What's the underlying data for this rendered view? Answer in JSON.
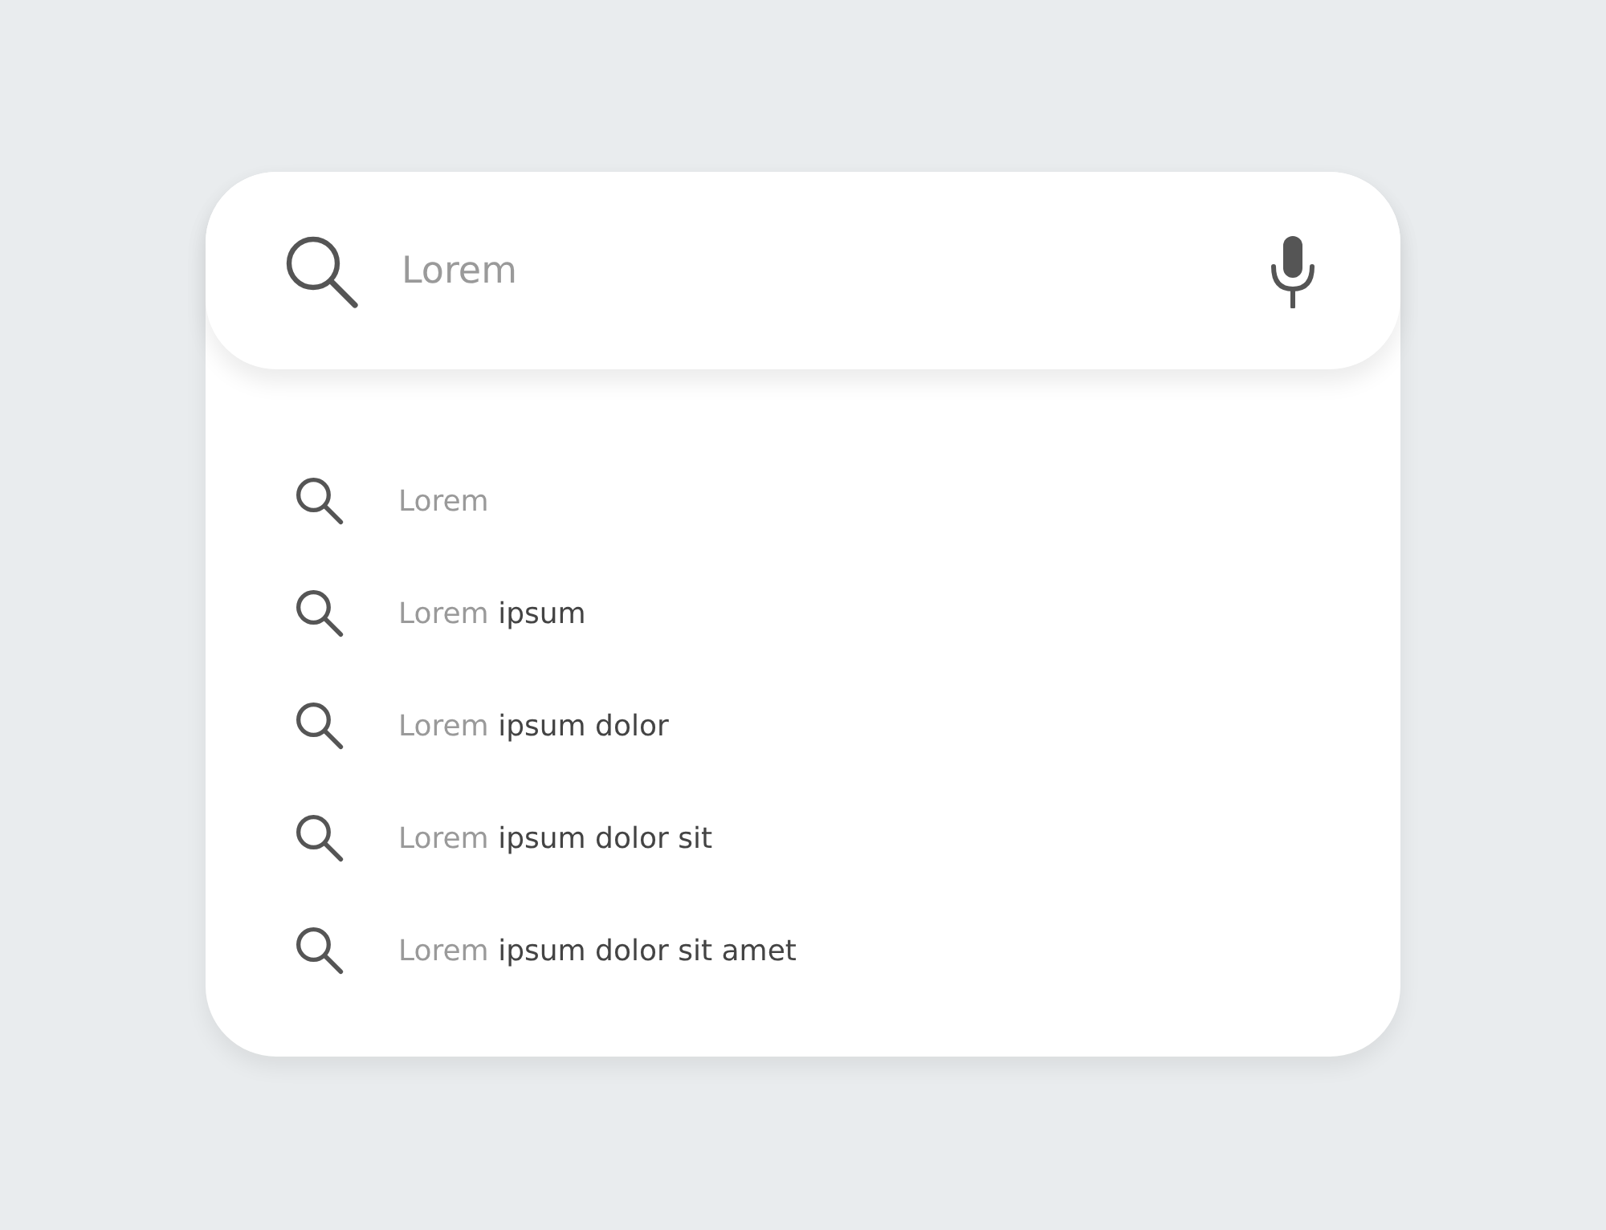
{
  "search": {
    "placeholder": "Lorem"
  },
  "suggestions": [
    {
      "match": "Lorem"
    },
    {
      "match": "Lorem",
      "completion": "ipsum"
    },
    {
      "match": "Lorem",
      "completion": "ipsum dolor"
    },
    {
      "match": "Lorem",
      "completion": "ipsum dolor sit"
    },
    {
      "match": "Lorem",
      "completion": "ipsum dolor sit amet"
    }
  ]
}
